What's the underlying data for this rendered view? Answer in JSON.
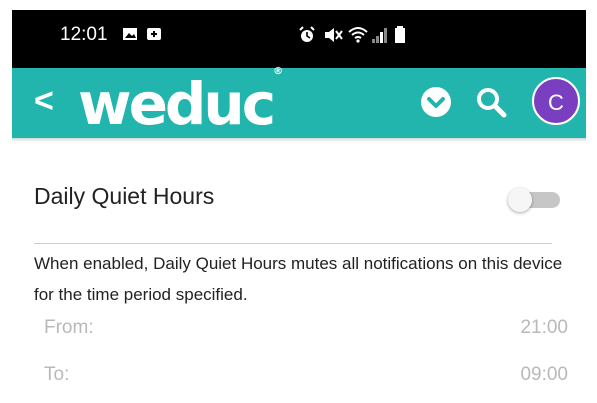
{
  "statusbar": {
    "time": "12:01",
    "left_icons": [
      "image-icon",
      "notification-icon"
    ],
    "right_icons": [
      "alarm-icon",
      "mute-icon",
      "wifi-icon",
      "signal-icon",
      "battery-icon"
    ]
  },
  "appbar": {
    "back_label": "<",
    "logo_text": "weduc",
    "logo_mark": "®",
    "avatar_letter": "C",
    "color": "#22b5ad",
    "avatar_color": "#7a3fc0"
  },
  "settings": {
    "title": "Daily Quiet Hours",
    "enabled": false,
    "description": "When enabled, Daily Quiet Hours mutes all notifications on this device for the time period specified.",
    "from_label": "From:",
    "from_value": "21:00",
    "to_label": "To:",
    "to_value": "09:00"
  }
}
